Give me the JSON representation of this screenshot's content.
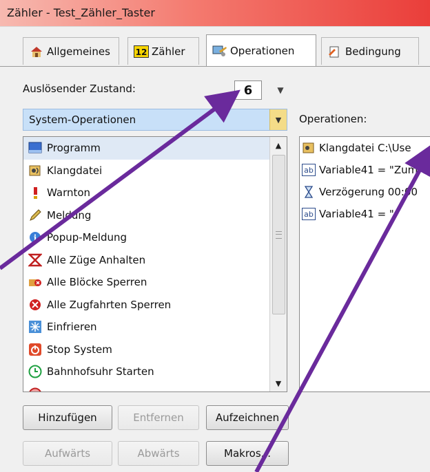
{
  "window": {
    "title": "Zähler - Test_Zähler_Taster"
  },
  "tabs": [
    {
      "label": "Allgemeines"
    },
    {
      "label": "Zähler"
    },
    {
      "label": "Operationen"
    },
    {
      "label": "Bedingung"
    }
  ],
  "trigger": {
    "label": "Auslösender Zustand:",
    "value": "6"
  },
  "category": {
    "selected": "System-Operationen"
  },
  "operations_label": "Operationen:",
  "system_operations": [
    {
      "label": "Programm"
    },
    {
      "label": "Klangdatei"
    },
    {
      "label": "Warnton"
    },
    {
      "label": "Meldung"
    },
    {
      "label": "Popup-Meldung"
    },
    {
      "label": "Alle Züge Anhalten"
    },
    {
      "label": "Alle Blöcke Sperren"
    },
    {
      "label": "Alle Zugfahrten Sperren"
    },
    {
      "label": "Einfrieren"
    },
    {
      "label": "Stop System"
    },
    {
      "label": "Bahnhofsuhr Starten"
    }
  ],
  "assigned_operations": [
    {
      "label": "Klangdatei C:\\Use"
    },
    {
      "label": "Variable41 = \"Zum"
    },
    {
      "label": "Verzögerung 00:00"
    },
    {
      "label": "Variable41 = \""
    }
  ],
  "buttons": {
    "add": "Hinzufügen",
    "remove": "Entfernen",
    "record": "Aufzeichnen",
    "up": "Aufwärts",
    "down": "Abwärts",
    "macros": "Makros..."
  },
  "colors": {
    "titlebar_accent": "#ea3e3a",
    "selection": "#c8e0f8",
    "annotation_arrow": "#6a2a9c"
  }
}
